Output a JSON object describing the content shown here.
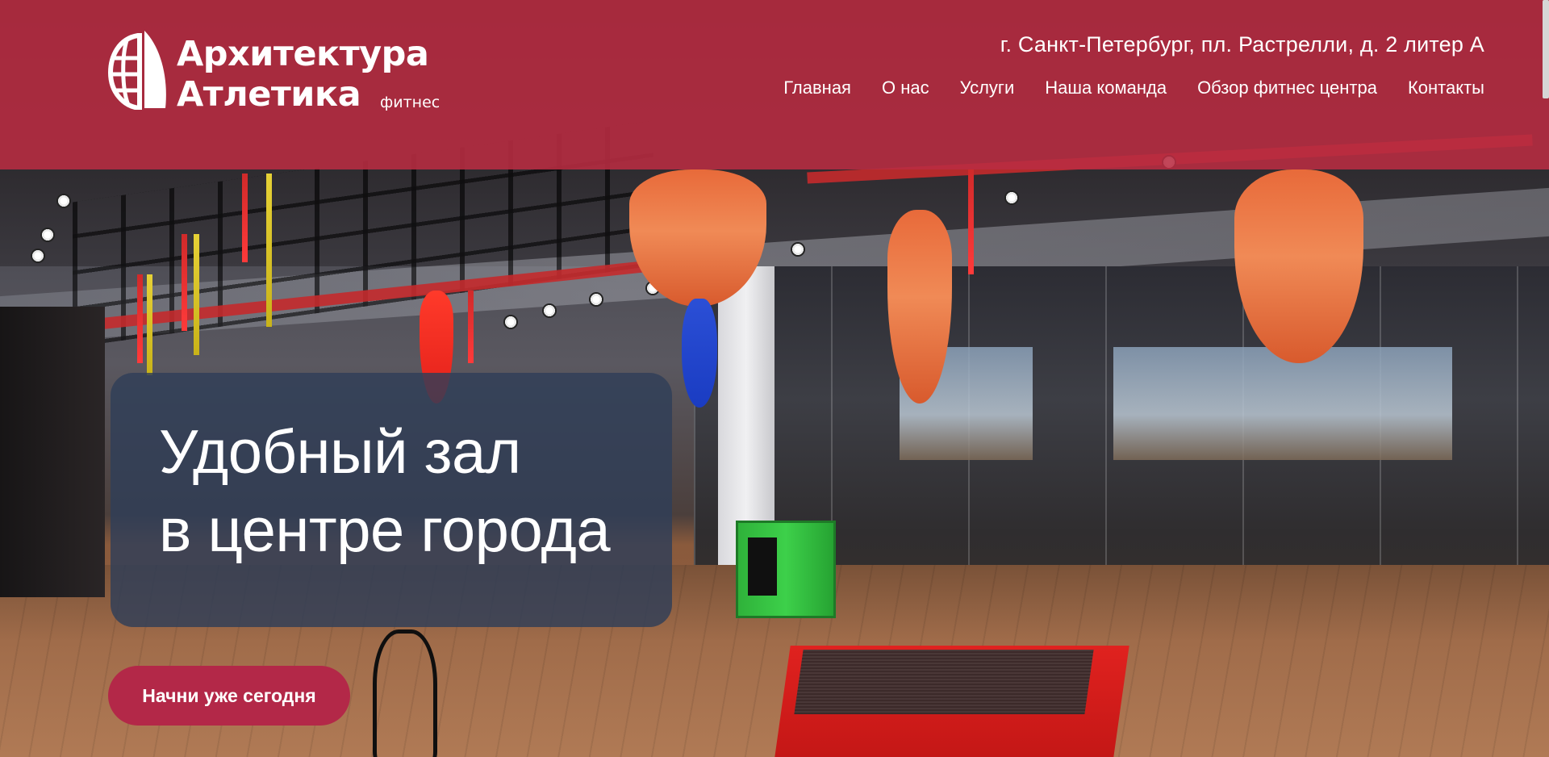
{
  "brand": {
    "name_line1": "Архитектура",
    "name_line2": "Атлетика",
    "sub": "фитнес",
    "logo_icon": "globe-sail-icon",
    "accent_color": "#b32848"
  },
  "header": {
    "address": "г. Санкт-Петербург, пл. Растрелли, д. 2 литер А"
  },
  "nav": {
    "items": [
      {
        "label": "Главная"
      },
      {
        "label": "О нас"
      },
      {
        "label": "Услуги"
      },
      {
        "label": "Наша команда"
      },
      {
        "label": "Обзор фитнес центра"
      },
      {
        "label": "Контакты"
      }
    ]
  },
  "hero": {
    "title_line1": "Удобный зал",
    "title_line2": "в центре города",
    "cta_label": "Начни уже сегодня"
  }
}
